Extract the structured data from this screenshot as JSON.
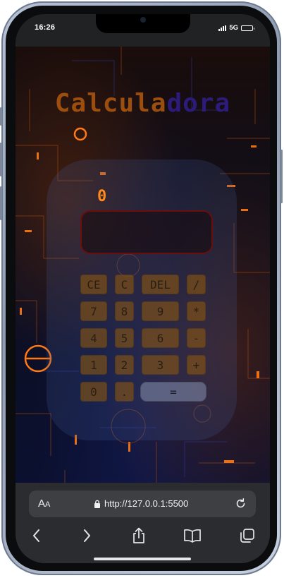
{
  "status_bar": {
    "time": "16:26",
    "network": "5G",
    "icons": [
      "signal-icon",
      "battery-icon"
    ]
  },
  "page": {
    "title_part1": "Calcula",
    "title_part2": "dora",
    "display_value": "0",
    "colors": {
      "title_part1": "#9c4e0e",
      "title_part2": "#2c1b7a",
      "display_value": "#ff8a1a",
      "keys": "#87551299"
    },
    "keys": {
      "ce": "CE",
      "c": "C",
      "del": "DEL",
      "divide": "/",
      "seven": "7",
      "eight": "8",
      "nine": "9",
      "multiply": "*",
      "four": "4",
      "five": "5",
      "six": "6",
      "minus": "-",
      "one": "1",
      "two": "2",
      "three": "3",
      "plus": "+",
      "zero": "0",
      "dot": ".",
      "equals": "="
    }
  },
  "browser": {
    "aa_big": "A",
    "aa_small": "A",
    "url": "http://127.0.0.1:5500",
    "icons": [
      "text-size-icon",
      "lock-icon",
      "reload-icon",
      "back-icon",
      "forward-icon",
      "share-icon",
      "bookmarks-icon",
      "tabs-icon"
    ]
  }
}
